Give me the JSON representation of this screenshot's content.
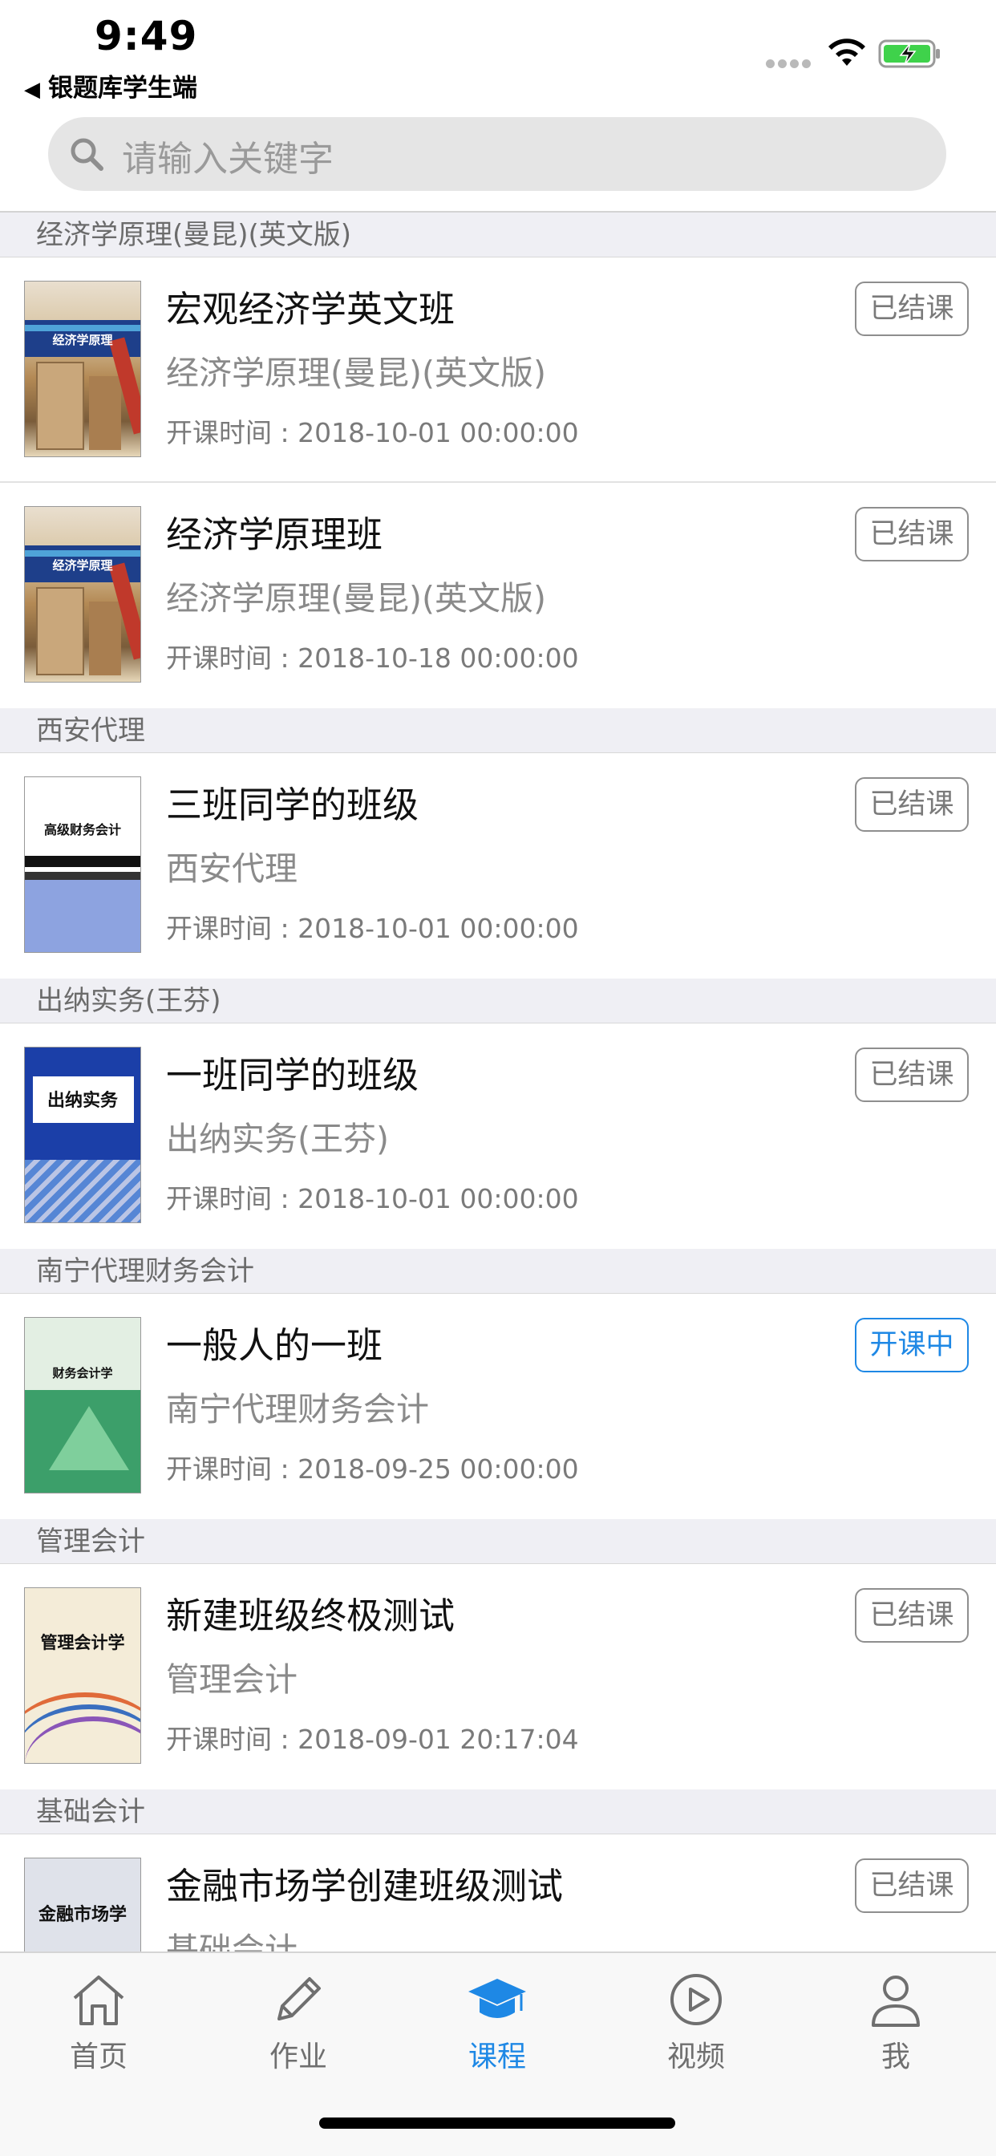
{
  "status_bar": {
    "time": "9:49",
    "back_app_label": "银题库学生端",
    "battery_color": "#3fd24b"
  },
  "search": {
    "placeholder": "请输入关键字"
  },
  "groups": [
    {
      "header": "经济学原理(曼昆)(英文版)",
      "courses": [
        {
          "title": "宏观经济学英文班",
          "subject": "经济学原理(曼昆)(英文版)",
          "time": "开课时间 : 2018-10-01 00:00:00",
          "status": "已结课",
          "cover": "economics-book-cover",
          "cover_text": "经济学原理"
        },
        {
          "title": "经济学原理班",
          "subject": "经济学原理(曼昆)(英文版)",
          "time": "开课时间 : 2018-10-18 00:00:00",
          "status": "已结课",
          "cover": "economics-book-cover",
          "cover_text": "经济学原理"
        }
      ]
    },
    {
      "header": "西安代理",
      "courses": [
        {
          "title": "三班同学的班级",
          "subject": "西安代理",
          "time": "开课时间 : 2018-10-01 00:00:00",
          "status": "已结课",
          "cover": "advanced-accounting-book-cover",
          "cover_text": "高级财务会计"
        }
      ]
    },
    {
      "header": "出纳实务(王芬)",
      "courses": [
        {
          "title": "一班同学的班级",
          "subject": "出纳实务(王芬)",
          "time": "开课时间 : 2018-10-01 00:00:00",
          "status": "已结课",
          "cover": "cashier-book-cover",
          "cover_text": "出纳实务"
        }
      ]
    },
    {
      "header": "南宁代理财务会计",
      "courses": [
        {
          "title": "一般人的一班",
          "subject": "南宁代理财务会计",
          "time": "开课时间 : 2018-09-25 00:00:00",
          "status": "开课中",
          "cover": "financial-accounting-book-cover",
          "cover_text": "财务会计学"
        }
      ]
    },
    {
      "header": "管理会计",
      "courses": [
        {
          "title": "新建班级终极测试",
          "subject": "管理会计",
          "time": "开课时间 : 2018-09-01 20:17:04",
          "status": "已结课",
          "cover": "management-accounting-book-cover",
          "cover_text": "管理会计学"
        }
      ]
    },
    {
      "header": "基础会计",
      "courses": [
        {
          "title": "金融市场学创建班级测试",
          "subject": "基础会计",
          "time": "",
          "status": "已结课",
          "cover": "financial-market-book-cover",
          "cover_text": "金融市场学"
        }
      ]
    }
  ],
  "tabs": [
    {
      "label": "首页",
      "icon": "home-icon",
      "active": false
    },
    {
      "label": "作业",
      "icon": "pencil-icon",
      "active": false
    },
    {
      "label": "课程",
      "icon": "graduation-cap-icon",
      "active": true
    },
    {
      "label": "视频",
      "icon": "play-circle-icon",
      "active": false
    },
    {
      "label": "我",
      "icon": "person-icon",
      "active": false
    }
  ],
  "colors": {
    "accent": "#1e88e5",
    "closed_badge": "#8e8e8e",
    "group_header_bg": "#efeff4"
  }
}
